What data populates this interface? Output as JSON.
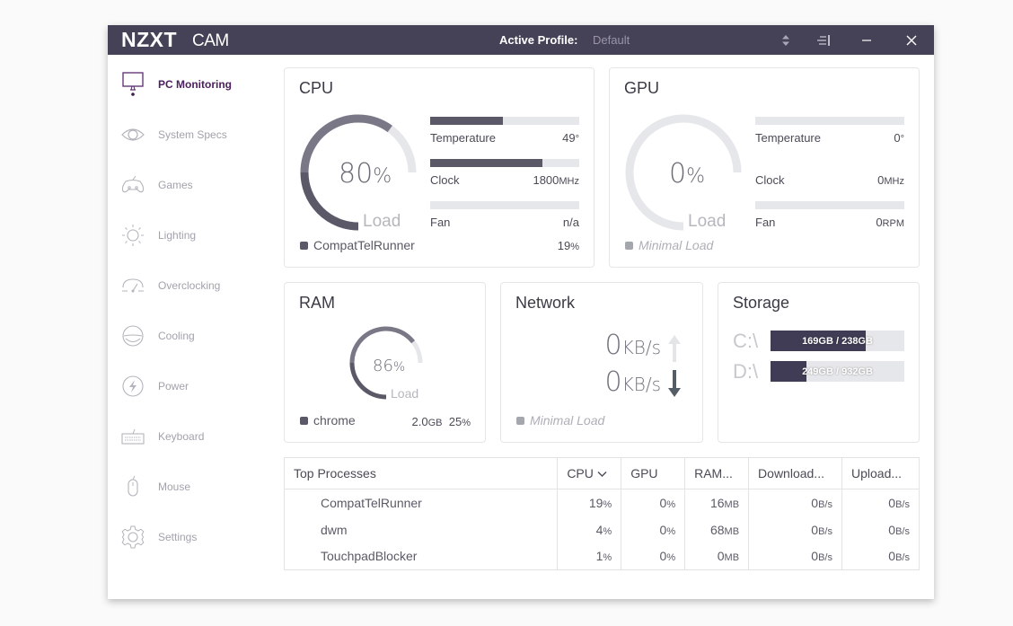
{
  "titlebar": {
    "logo_main": "NZXT",
    "logo_sub": "CAM",
    "active_profile_label": "Active Profile:",
    "active_profile_value": "Default",
    "icons": [
      "sort-updown-icon",
      "menu-collapse-icon",
      "minimize-icon",
      "close-icon"
    ]
  },
  "sidebar": {
    "items": [
      {
        "label": "PC Monitoring",
        "icon": "monitor-icon",
        "active": true
      },
      {
        "label": "System Specs",
        "icon": "eye-icon",
        "active": false
      },
      {
        "label": "Games",
        "icon": "gamepad-icon",
        "active": false
      },
      {
        "label": "Lighting",
        "icon": "sun-icon",
        "active": false
      },
      {
        "label": "Overclocking",
        "icon": "speedometer-icon",
        "active": false
      },
      {
        "label": "Cooling",
        "icon": "cooling-icon",
        "active": false
      },
      {
        "label": "Power",
        "icon": "lightning-icon",
        "active": false
      },
      {
        "label": "Keyboard",
        "icon": "keyboard-icon",
        "active": false
      },
      {
        "label": "Mouse",
        "icon": "mouse-icon",
        "active": false
      },
      {
        "label": "Settings",
        "icon": "gear-icon",
        "active": false
      }
    ]
  },
  "cpu": {
    "title": "CPU",
    "load_value": "80",
    "load_unit": "%",
    "load_fraction": 0.8,
    "load_label": "Load",
    "temperature": {
      "label": "Temperature",
      "value": "49",
      "unit": "°",
      "fraction": 0.49
    },
    "clock": {
      "label": "Clock",
      "value": "1800",
      "unit": "MHz",
      "fraction": 0.75
    },
    "fan": {
      "label": "Fan",
      "value": "n/a",
      "unit": "",
      "fraction": 0
    },
    "top_process": {
      "name": "CompatTelRunner",
      "value": "19",
      "unit": "%"
    }
  },
  "gpu": {
    "title": "GPU",
    "load_value": "0",
    "load_unit": "%",
    "load_fraction": 0,
    "load_label": "Load",
    "temperature": {
      "label": "Temperature",
      "value": "0",
      "unit": "°",
      "fraction": 0
    },
    "clock": {
      "label": "Clock",
      "value": "0",
      "unit": "MHz"
    },
    "fan": {
      "label": "Fan",
      "value": "0",
      "unit": "RPM",
      "fraction": 0
    },
    "status": "Minimal Load"
  },
  "ram": {
    "title": "RAM",
    "load_value": "86",
    "load_unit": "%",
    "load_fraction": 0.86,
    "load_label": "Load",
    "top_process": {
      "name": "chrome",
      "size": "2.0",
      "size_unit": "GB",
      "percent": "25",
      "percent_unit": "%"
    }
  },
  "network": {
    "title": "Network",
    "upload": {
      "value": "0",
      "unit": "KB/s"
    },
    "download": {
      "value": "0",
      "unit": "KB/s"
    },
    "status": "Minimal Load"
  },
  "storage": {
    "title": "Storage",
    "drives": [
      {
        "label": "C:\\",
        "text": "169GB / 238GB",
        "fraction": 0.71
      },
      {
        "label": "D:\\",
        "text": "249GB / 932GB",
        "fraction": 0.267
      }
    ]
  },
  "processes": {
    "columns": [
      "Top Processes",
      "CPU",
      "GPU",
      "RAM...",
      "Download...",
      "Upload..."
    ],
    "sort_column": "CPU",
    "rows": [
      {
        "name": "CompatTelRunner",
        "cpu": "19",
        "gpu": "0",
        "ram": "16",
        "download": "0",
        "upload": "0"
      },
      {
        "name": "dwm",
        "cpu": "4",
        "gpu": "0",
        "ram": "68",
        "download": "0",
        "upload": "0"
      },
      {
        "name": "TouchpadBlocker",
        "cpu": "1",
        "gpu": "0",
        "ram": "0",
        "download": "0",
        "upload": "0"
      }
    ],
    "units": {
      "cpu": "%",
      "gpu": "%",
      "ram": "MB",
      "download": "B/s",
      "upload": "B/s"
    }
  },
  "colors": {
    "titlebar": "#454156",
    "accent": "#4b1e5c",
    "gauge_dark": "#5b5868",
    "gauge_light": "#7a7787",
    "gauge_track": "#e6e7ea",
    "drive_fill": "#403c55"
  }
}
